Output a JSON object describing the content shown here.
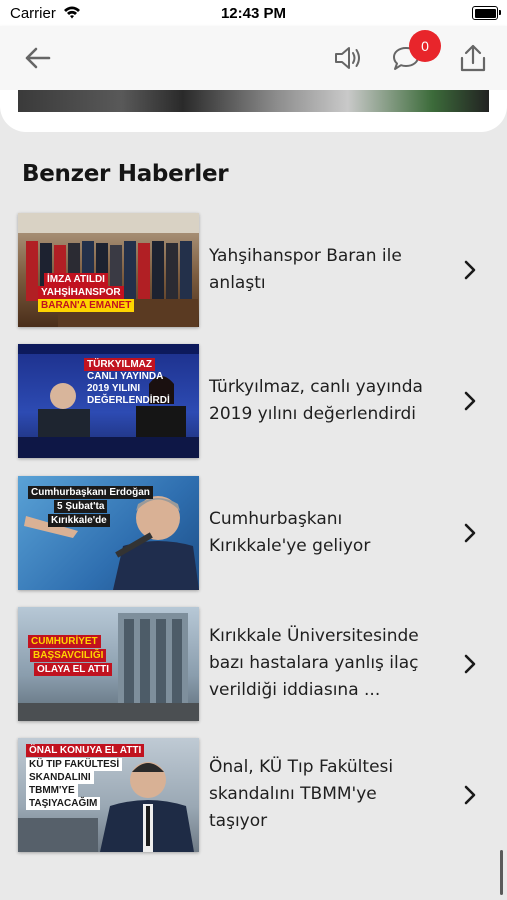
{
  "status_bar": {
    "carrier": "Carrier",
    "time": "12:43 PM"
  },
  "toolbar": {
    "comment_count": "0"
  },
  "related": {
    "heading": "Benzer Haberler",
    "items": [
      {
        "title_line1": "Yahşihanspor Baran ile",
        "title_line2": "anlaştı",
        "title_line3": "",
        "caption": [
          "İMZA ATILDI",
          "YAHŞİHANSPOR",
          "BARAN'A EMANET"
        ]
      },
      {
        "title_line1": "Türkyılmaz, canlı yayında",
        "title_line2": "2019 yılını değerlendirdi",
        "title_line3": "",
        "caption": [
          "TÜRKYILMAZ",
          "CANLI YAYINDA",
          "2019 YILINI",
          "DEĞERLENDİRDİ"
        ]
      },
      {
        "title_line1": "Cumhurbaşkanı",
        "title_line2": "Kırıkkale'ye geliyor",
        "title_line3": "",
        "caption": [
          "Cumhurbaşkanı Erdoğan",
          "5 Şubat'ta",
          "Kırıkkale'de"
        ]
      },
      {
        "title_line1": "Kırıkkale Üniversitesinde",
        "title_line2": "bazı hastalara yanlış ilaç",
        "title_line3": "verildiği iddiasına ...",
        "caption": [
          "CUMHURİYET",
          "BAŞSAVCILIĞI",
          "OLAYA EL ATTI"
        ]
      },
      {
        "title_line1": "Önal, KÜ Tıp Fakültesi",
        "title_line2": "skandalını TBMM'ye",
        "title_line3": "taşıyor",
        "caption": [
          "ÖNAL KONUYA EL ATTI",
          "KÜ TIP FAKÜLTESİ",
          "SKANDALINI",
          "TBMM'YE",
          "TAŞIYACAĞIM"
        ]
      }
    ]
  },
  "colors": {
    "badge": "#e8252b",
    "background": "#e9e9e9",
    "toolbar": "#f7f7f7"
  },
  "icons": [
    "wifi-icon",
    "battery-icon",
    "back-arrow-icon",
    "speaker-icon",
    "comment-icon",
    "share-icon",
    "chevron-right-icon"
  ]
}
